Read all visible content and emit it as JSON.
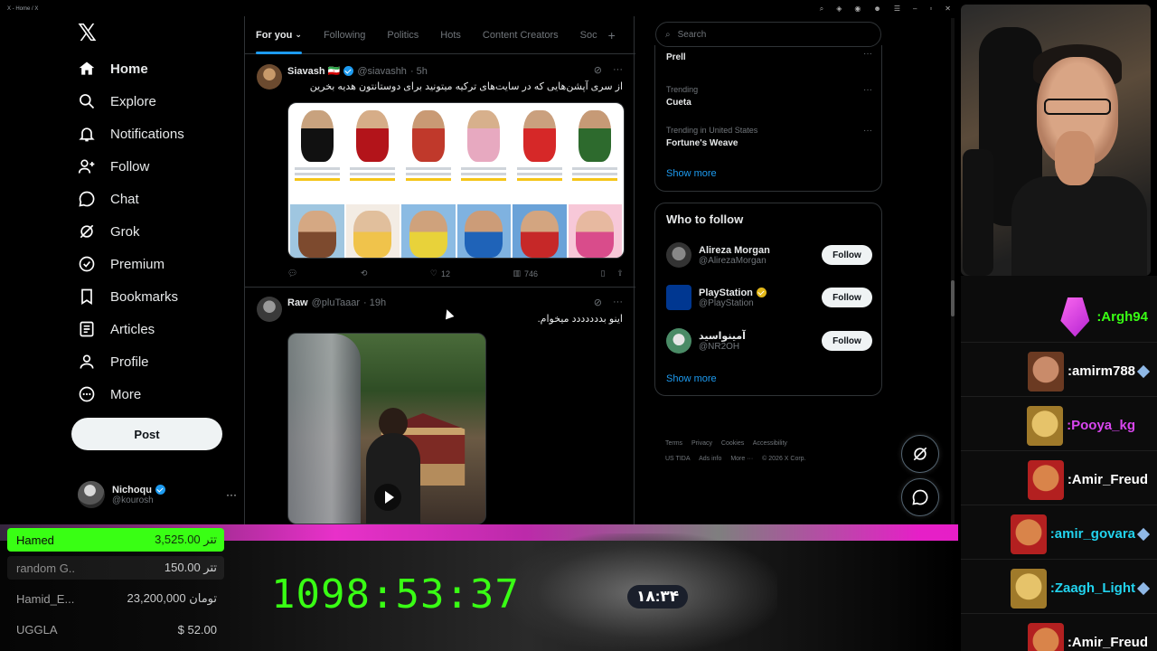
{
  "window": {
    "title": "X - Home / X"
  },
  "nav": {
    "items": [
      {
        "label": "Home",
        "icon": "home-icon",
        "active": true
      },
      {
        "label": "Explore",
        "icon": "search-icon"
      },
      {
        "label": "Notifications",
        "icon": "bell-icon"
      },
      {
        "label": "Follow",
        "icon": "person-add-icon"
      },
      {
        "label": "Chat",
        "icon": "chat-icon"
      },
      {
        "label": "Grok",
        "icon": "grok-icon"
      },
      {
        "label": "Premium",
        "icon": "premium-icon"
      },
      {
        "label": "Bookmarks",
        "icon": "bookmark-icon"
      },
      {
        "label": "Articles",
        "icon": "article-icon"
      },
      {
        "label": "Profile",
        "icon": "person-icon"
      },
      {
        "label": "More",
        "icon": "more-circle-icon"
      }
    ],
    "post_label": "Post",
    "account": {
      "display_name": "Nichoqu",
      "handle": "@kourosh"
    }
  },
  "tabs": [
    "For you",
    "Following",
    "Politics",
    "Hots",
    "Content Creators",
    "Soc"
  ],
  "tweets": [
    {
      "name": "Siavash 🇮🇷",
      "handle": "@siavashh",
      "time": "· 5h",
      "text": "از سری آپشن‌هایی که در سایت‌های ترکیه میتونید برای دوستانتون هدیه بخرین",
      "likes": "12",
      "views": "746"
    },
    {
      "name": "Raw",
      "handle": "@pluTaaar",
      "time": "· 19h",
      "text": "اینو بددددددد میخوام."
    }
  ],
  "search": {
    "placeholder": "Search"
  },
  "trends": [
    {
      "context": "",
      "name": "Prell"
    },
    {
      "context": "Trending",
      "name": "Cueta"
    },
    {
      "context": "Trending in United States",
      "name": "Fortune's Weave"
    }
  ],
  "trends_show_more": "Show more",
  "who_to_follow": {
    "title": "Who to follow",
    "users": [
      {
        "name": "Alireza Morgan",
        "handle": "@AlirezaMorgan",
        "verified": false
      },
      {
        "name": "PlayStation",
        "handle": "@PlayStation",
        "verified": true
      },
      {
        "name": "آمینواسید",
        "handle": "@NR2OH",
        "verified": false
      }
    ],
    "follow_label": "Follow",
    "show_more": "Show more"
  },
  "footer": {
    "links": [
      "Terms",
      "Privacy",
      "Cookies",
      "Accessibility",
      "US TIDA",
      "Ads info",
      "More ···",
      "© 2026 X Corp."
    ]
  },
  "chat": {
    "messages": [
      {
        "name": ":Argh94",
        "color": "#39ff14",
        "gem": false
      },
      {
        "name": ":amirm788",
        "color": "#ffffff",
        "gem": true
      },
      {
        "name": ":Pooya_kg",
        "color": "#d946ef",
        "gem": false
      },
      {
        "name": ":Amir_Freud",
        "color": "#ffffff",
        "gem": false
      },
      {
        "name": ":amir_govara",
        "color": "#22d3ee",
        "gem": true
      },
      {
        "name": ":Zaagh_Light",
        "color": "#22d3ee",
        "gem": true
      },
      {
        "name": ":Amir_Freud",
        "color": "#ffffff",
        "gem": false
      }
    ]
  },
  "donations": [
    {
      "name": "Hamed",
      "amount": "تتر 3,525.00"
    },
    {
      "name": "random G..",
      "amount": "تتر 150.00"
    },
    {
      "name": "Hamid_E...",
      "amount": "تومان 23,200,000"
    },
    {
      "name": "UGGLA",
      "amount": "$ 52.00"
    }
  ],
  "timer": "1098:53:37",
  "clock": "۱۸:۳۴",
  "colors": {
    "accent": "#1d9bf0",
    "top_donor_bg": "#39ff14",
    "timer": "#39ff14"
  }
}
